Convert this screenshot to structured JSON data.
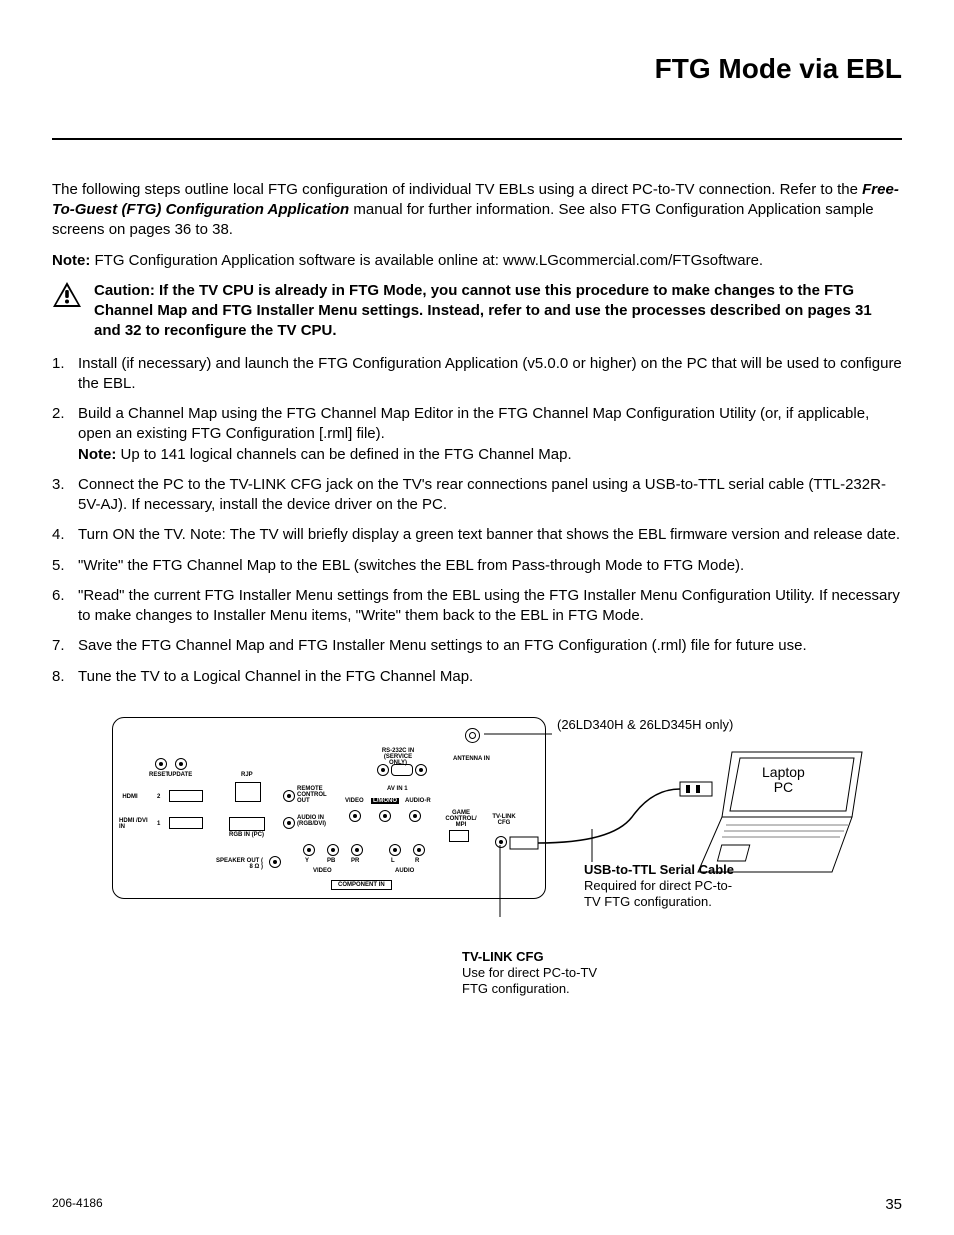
{
  "header": {
    "title": "FTG Mode via EBL"
  },
  "intro": {
    "p1_a": "The following steps outline local FTG configuration of individual TV EBLs using a direct PC-to-TV connection. Refer to the ",
    "p1_em": "Free-To-Guest (FTG) Configuration Application",
    "p1_b": " manual for further information. See also FTG Configuration Application sample screens on pages 36 to 38.",
    "note_label": "Note:",
    "note_body": " FTG Configuration Application software is available online at: www.LGcommercial.com/FTGsoftware."
  },
  "caution": "Caution: If the TV CPU is already in FTG Mode, you cannot use this procedure to make changes to the FTG Channel Map and FTG Installer Menu settings. Instead, refer to and use the processes described on pages 31 and 32 to reconfigure the TV CPU.",
  "steps": [
    {
      "text": "Install (if necessary) and launch the FTG Configuration Application (v5.0.0 or higher) on the PC that will be used to configure the EBL."
    },
    {
      "text": "Build a Channel Map using the FTG Channel Map Editor in the FTG Channel Map Configuration Utility (or, if applicable, open an existing FTG Configuration [.rml] file).",
      "note_label": "Note:",
      "note_body": " Up to 141 logical channels can be defined in the FTG Channel Map."
    },
    {
      "text": "Connect the PC to the TV-LINK CFG jack on the TV's rear connections panel using a USB-to-TTL serial cable (TTL-232R-5V-AJ). If necessary, install the device driver on the PC."
    },
    {
      "text": "Turn ON the TV. Note: The TV will briefly display a green text banner that shows the EBL firmware version and release date."
    },
    {
      "text": "\"Write\" the FTG Channel Map to the EBL (switches the EBL from Pass-through Mode to FTG Mode)."
    },
    {
      "text": "\"Read\" the current FTG Installer Menu settings from the EBL using the FTG Installer Menu Configuration Utility. If necessary to make changes to Installer Menu items, \"Write\" them back to the EBL in FTG Mode."
    },
    {
      "text": "Save the FTG Channel Map and FTG Installer Menu settings to an FTG Configuration (.rml) file for future use."
    },
    {
      "text": "Tune the TV to a Logical Channel in the FTG Channel Map."
    }
  ],
  "diagram": {
    "antenna_note": "(26LD340H & 26LD345H only)",
    "laptop_label_1": "Laptop",
    "laptop_label_2": "PC",
    "tvlink": {
      "h": "TV-LINK CFG",
      "body": "Use for direct PC-to-TV FTG configuration."
    },
    "usb": {
      "h": "USB-to-TTL Serial Cable",
      "body": "Required for direct PC-to-TV FTG configuration."
    },
    "ports": {
      "reset": "RESET",
      "update": "UPDATE",
      "rjp": "RJP",
      "hdmi": "HDMI",
      "hdmi_dvi": "HDMI /DVI IN",
      "n1": "1",
      "n2": "2",
      "rgb": "RGB IN (PC)",
      "audio_rgb": "AUDIO IN (RGB/DVI)",
      "remote": "REMOTE CONTROL OUT",
      "rs232": "RS-232C IN (SERVICE ONLY)",
      "antenna": "ANTENNA IN",
      "avin": "AV IN 1",
      "video": "VIDEO",
      "lmono": "L/MONO",
      "audio_r": "AUDIO-R",
      "game": "GAME CONTROL/ MPI",
      "tvlink": "TV-LINK CFG",
      "speaker": "SPEAKER OUT ( 8 Ω )",
      "component": "COMPONENT IN",
      "y": "Y",
      "pb": "PB",
      "pr": "PR",
      "l": "L",
      "r": "R",
      "audio": "AUDIO",
      "videob": "VIDEO"
    }
  },
  "footer": {
    "docnum": "206-4186",
    "pagenum": "35"
  }
}
